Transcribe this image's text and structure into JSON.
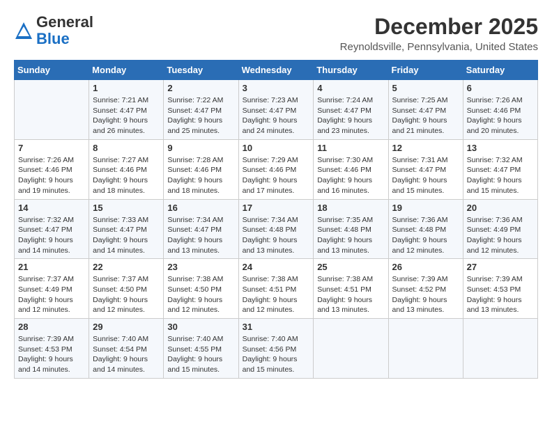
{
  "header": {
    "logo_line1": "General",
    "logo_line2": "Blue",
    "month": "December 2025",
    "location": "Reynoldsville, Pennsylvania, United States"
  },
  "days_of_week": [
    "Sunday",
    "Monday",
    "Tuesday",
    "Wednesday",
    "Thursday",
    "Friday",
    "Saturday"
  ],
  "weeks": [
    [
      {
        "day": "",
        "info": ""
      },
      {
        "day": "1",
        "info": "Sunrise: 7:21 AM\nSunset: 4:47 PM\nDaylight: 9 hours\nand 26 minutes."
      },
      {
        "day": "2",
        "info": "Sunrise: 7:22 AM\nSunset: 4:47 PM\nDaylight: 9 hours\nand 25 minutes."
      },
      {
        "day": "3",
        "info": "Sunrise: 7:23 AM\nSunset: 4:47 PM\nDaylight: 9 hours\nand 24 minutes."
      },
      {
        "day": "4",
        "info": "Sunrise: 7:24 AM\nSunset: 4:47 PM\nDaylight: 9 hours\nand 23 minutes."
      },
      {
        "day": "5",
        "info": "Sunrise: 7:25 AM\nSunset: 4:47 PM\nDaylight: 9 hours\nand 21 minutes."
      },
      {
        "day": "6",
        "info": "Sunrise: 7:26 AM\nSunset: 4:46 PM\nDaylight: 9 hours\nand 20 minutes."
      }
    ],
    [
      {
        "day": "7",
        "info": "Sunrise: 7:26 AM\nSunset: 4:46 PM\nDaylight: 9 hours\nand 19 minutes."
      },
      {
        "day": "8",
        "info": "Sunrise: 7:27 AM\nSunset: 4:46 PM\nDaylight: 9 hours\nand 18 minutes."
      },
      {
        "day": "9",
        "info": "Sunrise: 7:28 AM\nSunset: 4:46 PM\nDaylight: 9 hours\nand 18 minutes."
      },
      {
        "day": "10",
        "info": "Sunrise: 7:29 AM\nSunset: 4:46 PM\nDaylight: 9 hours\nand 17 minutes."
      },
      {
        "day": "11",
        "info": "Sunrise: 7:30 AM\nSunset: 4:46 PM\nDaylight: 9 hours\nand 16 minutes."
      },
      {
        "day": "12",
        "info": "Sunrise: 7:31 AM\nSunset: 4:47 PM\nDaylight: 9 hours\nand 15 minutes."
      },
      {
        "day": "13",
        "info": "Sunrise: 7:32 AM\nSunset: 4:47 PM\nDaylight: 9 hours\nand 15 minutes."
      }
    ],
    [
      {
        "day": "14",
        "info": "Sunrise: 7:32 AM\nSunset: 4:47 PM\nDaylight: 9 hours\nand 14 minutes."
      },
      {
        "day": "15",
        "info": "Sunrise: 7:33 AM\nSunset: 4:47 PM\nDaylight: 9 hours\nand 14 minutes."
      },
      {
        "day": "16",
        "info": "Sunrise: 7:34 AM\nSunset: 4:47 PM\nDaylight: 9 hours\nand 13 minutes."
      },
      {
        "day": "17",
        "info": "Sunrise: 7:34 AM\nSunset: 4:48 PM\nDaylight: 9 hours\nand 13 minutes."
      },
      {
        "day": "18",
        "info": "Sunrise: 7:35 AM\nSunset: 4:48 PM\nDaylight: 9 hours\nand 13 minutes."
      },
      {
        "day": "19",
        "info": "Sunrise: 7:36 AM\nSunset: 4:48 PM\nDaylight: 9 hours\nand 12 minutes."
      },
      {
        "day": "20",
        "info": "Sunrise: 7:36 AM\nSunset: 4:49 PM\nDaylight: 9 hours\nand 12 minutes."
      }
    ],
    [
      {
        "day": "21",
        "info": "Sunrise: 7:37 AM\nSunset: 4:49 PM\nDaylight: 9 hours\nand 12 minutes."
      },
      {
        "day": "22",
        "info": "Sunrise: 7:37 AM\nSunset: 4:50 PM\nDaylight: 9 hours\nand 12 minutes."
      },
      {
        "day": "23",
        "info": "Sunrise: 7:38 AM\nSunset: 4:50 PM\nDaylight: 9 hours\nand 12 minutes."
      },
      {
        "day": "24",
        "info": "Sunrise: 7:38 AM\nSunset: 4:51 PM\nDaylight: 9 hours\nand 12 minutes."
      },
      {
        "day": "25",
        "info": "Sunrise: 7:38 AM\nSunset: 4:51 PM\nDaylight: 9 hours\nand 13 minutes."
      },
      {
        "day": "26",
        "info": "Sunrise: 7:39 AM\nSunset: 4:52 PM\nDaylight: 9 hours\nand 13 minutes."
      },
      {
        "day": "27",
        "info": "Sunrise: 7:39 AM\nSunset: 4:53 PM\nDaylight: 9 hours\nand 13 minutes."
      }
    ],
    [
      {
        "day": "28",
        "info": "Sunrise: 7:39 AM\nSunset: 4:53 PM\nDaylight: 9 hours\nand 14 minutes."
      },
      {
        "day": "29",
        "info": "Sunrise: 7:40 AM\nSunset: 4:54 PM\nDaylight: 9 hours\nand 14 minutes."
      },
      {
        "day": "30",
        "info": "Sunrise: 7:40 AM\nSunset: 4:55 PM\nDaylight: 9 hours\nand 15 minutes."
      },
      {
        "day": "31",
        "info": "Sunrise: 7:40 AM\nSunset: 4:56 PM\nDaylight: 9 hours\nand 15 minutes."
      },
      {
        "day": "",
        "info": ""
      },
      {
        "day": "",
        "info": ""
      },
      {
        "day": "",
        "info": ""
      }
    ]
  ]
}
